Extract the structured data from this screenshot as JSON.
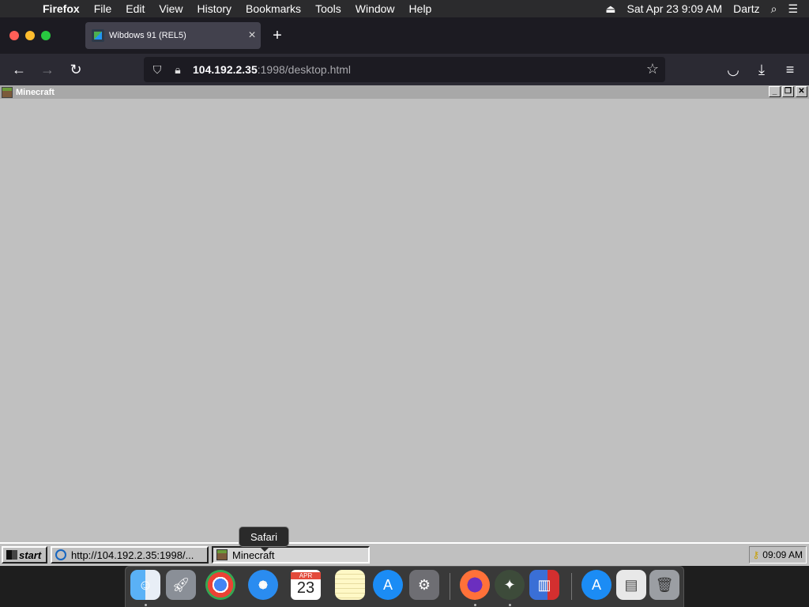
{
  "menubar": {
    "app": "Firefox",
    "items": [
      "File",
      "Edit",
      "View",
      "History",
      "Bookmarks",
      "Tools",
      "Window",
      "Help"
    ],
    "datetime": "Sat Apr 23  9:09 AM",
    "user": "Dartz"
  },
  "browser": {
    "tab_title": "Wibdows 91 (REL5)",
    "url_host": "104.192.2.35",
    "url_rest": ":1998/desktop.html"
  },
  "desktop": {
    "window_title": "Minecraft",
    "taskbar": {
      "start_label": "start",
      "items": [
        "http://104.192.2.35:1998/...",
        "Minecraft"
      ],
      "clock": "09:09 AM"
    }
  },
  "dock": {
    "tooltip": "Safari",
    "calendar_month": "APR",
    "calendar_day": "23",
    "apps": [
      "Finder",
      "Launchpad",
      "Chrome",
      "Safari",
      "Calendar",
      "Notes",
      "App Store",
      "System Preferences",
      "Firefox",
      "Scrobbler",
      "Parallels",
      "App Store Downloads",
      "Documents",
      "Trash"
    ]
  },
  "colors": {
    "desktop_bg": "#c0c0c0",
    "menubar_bg": "#2b2b2d",
    "firefox_toolbar": "#2b2a33"
  }
}
